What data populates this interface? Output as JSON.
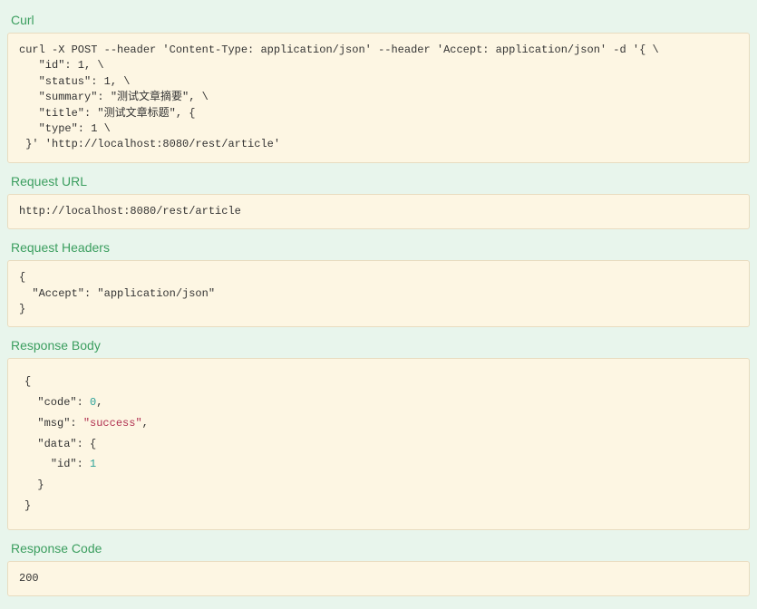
{
  "sections": {
    "curl": {
      "heading": "Curl",
      "content": "curl -X POST --header 'Content-Type: application/json' --header 'Accept: application/json' -d '{ \\\n   \"id\": 1, \\\n   \"status\": 1, \\\n   \"summary\": \"测试文章摘要\", \\\n   \"title\": \"测试文章标题\", {\n   \"type\": 1 \\\n }' 'http://localhost:8080/rest/article'"
    },
    "request_url": {
      "heading": "Request URL",
      "content": "http://localhost:8080/rest/article"
    },
    "request_headers": {
      "heading": "Request Headers",
      "content": "{\n  \"Accept\": \"application/json\"\n}"
    },
    "response_body": {
      "heading": "Response Body",
      "json": {
        "code": 0,
        "msg": "success",
        "data": {
          "id": 1
        }
      }
    },
    "response_code": {
      "heading": "Response Code",
      "content": "200"
    }
  }
}
